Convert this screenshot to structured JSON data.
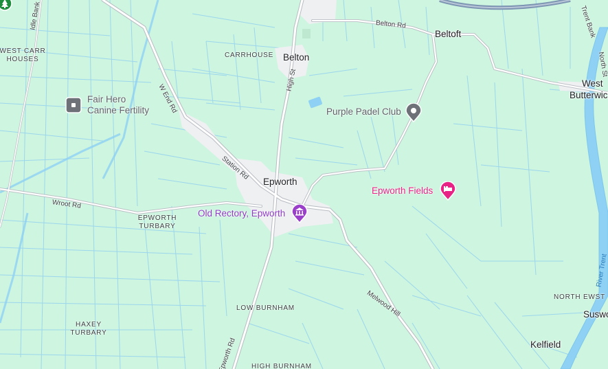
{
  "map": {
    "colors": {
      "land": "#cdf5df",
      "water": "#8ed1f5",
      "drain": "#9ad5ee",
      "road": "#ffffff",
      "road_casing": "#b8bcc2",
      "motorway": "#7d95b2",
      "settlement": "#eef0f2",
      "poi_gray": "#6e7278",
      "poi_pink": "#e72485",
      "poi_purple": "#9a3fca"
    },
    "towns": {
      "belton": "Belton",
      "beltoft": "Beltoft",
      "epworth": "Epworth",
      "west": "West",
      "butterwick": "Butterwick",
      "susworth": "Suswo",
      "kelfield": "Kelfield"
    },
    "hamlets": {
      "west_carr_houses_1": "WEST CARR",
      "west_carr_houses_2": "HOUSES",
      "carrhouse": "CARRHOUSE",
      "epworth_turbary_1": "EPWORTH",
      "epworth_turbary_2": "TURBARY",
      "low_burnham": "LOW BURNHAM",
      "haxey_turbary_1": "HAXEY",
      "haxey_turbary_2": "TURBARY",
      "high_burnham": "HIGH BURNHAM",
      "north_ewster": "NORTH EWST"
    },
    "roads": {
      "belton_rd": "Belton Rd",
      "idle_bank": "Idle Bank",
      "w_end_rd": "W End Rd",
      "station_rd": "Station Rd",
      "high_st": "High St",
      "wroot_rd": "Wroot Rd",
      "melwood_hill": "Melwood Hill",
      "epworth_rd": "Epworth Rd",
      "trent_bank": "Trent Bank",
      "north_st": "North St"
    },
    "rivers": {
      "river_trent": "River Trent"
    },
    "pois": {
      "fair_hero_1": "Fair Hero",
      "fair_hero_2": "Canine Fertility",
      "purple_padel": "Purple Padel Club",
      "epworth_fields": "Epworth Fields",
      "old_rectory": "Old Rectory, Epworth"
    },
    "icons": {
      "fair_hero": "square-marker-icon",
      "purple_padel": "pin-marker-icon",
      "epworth_fields": "hotel-bed-icon",
      "old_rectory": "museum-icon",
      "top_left": "tree-park-icon"
    }
  }
}
